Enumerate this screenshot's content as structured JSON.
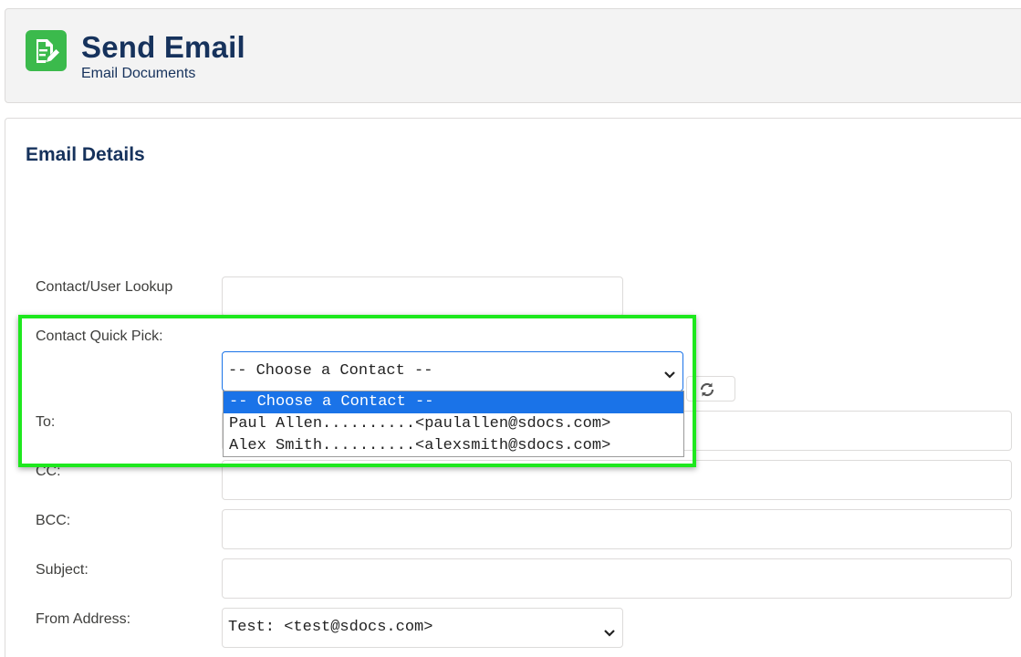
{
  "header": {
    "title": "Send Email",
    "subtitle": "Email Documents",
    "icon": "document-edit-icon",
    "icon_color": "#3bba4c"
  },
  "section": {
    "title": "Email Details"
  },
  "fields": {
    "contact_lookup": {
      "label": "Contact/User Lookup",
      "value": ""
    },
    "quick_pick": {
      "label": "Contact Quick Pick:",
      "selected": "-- Choose a Contact --",
      "options": [
        "-- Choose a Contact --",
        "Paul Allen..........<paulallen@sdocs.com>",
        "Alex Smith..........<alexsmith@sdocs.com>"
      ]
    },
    "to": {
      "label": "To:",
      "value": ""
    },
    "cc": {
      "label": "CC:",
      "value": ""
    },
    "bcc": {
      "label": "BCC:",
      "value": ""
    },
    "subject": {
      "label": "Subject:",
      "value": ""
    },
    "from_address": {
      "label": "From Address:",
      "selected": "Test: <test@sdocs.com>"
    }
  },
  "refresh_button": {
    "icon": "refresh-icon"
  },
  "colors": {
    "highlight": "#1ee81e",
    "dropdown_selected": "#1a73e8",
    "heading": "#16325c"
  }
}
